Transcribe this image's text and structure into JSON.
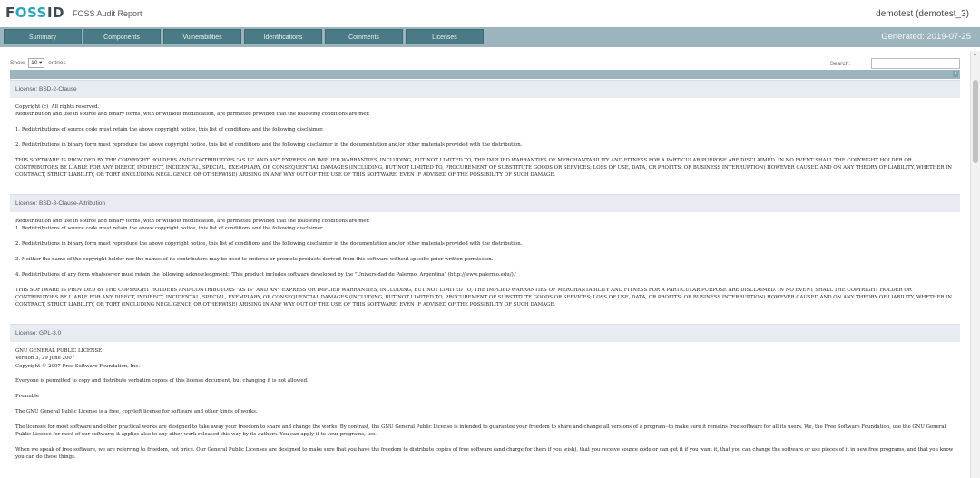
{
  "header": {
    "logo_part1": "F",
    "logo_part2": "OSS",
    "logo_part3": "ID",
    "report_title": "FOSS Audit Report",
    "user": "demotest (demotest_3)"
  },
  "nav": {
    "tabs": [
      "Summary",
      "Components",
      "Vulnerabilities",
      "Identifications",
      "Comments",
      "Licenses"
    ],
    "active": "Licenses",
    "generated": "Generated: 2019-07-25"
  },
  "table_controls": {
    "show_label": "Show",
    "entries_value": "10",
    "entries_label": "entries",
    "search_label": "Search:",
    "search_value": ""
  },
  "licenses": [
    {
      "header": "License: BSD-2-Clause",
      "paragraphs": [
        "Copyright (c)  All rights reserved.\nRedistribution and use in source and binary forms, with or without modification, are permitted provided that the following conditions are met:",
        "1. Redistributions of source code must retain the above copyright notice, this list of conditions and the following disclaimer.",
        "2. Redistributions in binary form must reproduce the above copyright notice, this list of conditions and the following disclaimer in the documentation and/or other materials provided with the distribution.",
        "THIS SOFTWARE IS PROVIDED BY THE COPYRIGHT HOLDERS AND CONTRIBUTORS \"AS IS\" AND ANY EXPRESS OR IMPLIED WARRANTIES, INCLUDING, BUT NOT LIMITED TO, THE IMPLIED WARRANTIES OF MERCHANTABILITY AND FITNESS FOR A PARTICULAR PURPOSE ARE DISCLAIMED. IN NO EVENT SHALL THE COPYRIGHT HOLDER OR CONTRIBUTORS BE LIABLE FOR ANY DIRECT, INDIRECT, INCIDENTAL, SPECIAL, EXEMPLARY, OR CONSEQUENTIAL DAMAGES (INCLUDING, BUT NOT LIMITED TO, PROCUREMENT OF SUBSTITUTE GOODS OR SERVICES; LOSS OF USE, DATA, OR PROFITS; OR BUSINESS INTERRUPTION) HOWEVER CAUSED AND ON ANY THEORY OF LIABILITY, WHETHER IN CONTRACT, STRICT LIABILITY, OR TORT (INCLUDING NEGLIGENCE OR OTHERWISE) ARISING IN ANY WAY OUT OF THE USE OF THIS SOFTWARE, EVEN IF ADVISED OF THE POSSIBILITY OF SUCH DAMAGE."
      ]
    },
    {
      "header": "License: BSD-3-Clause-Attribution",
      "paragraphs": [
        "Redistribution and use in source and binary forms, with or without modification, are permitted provided that the following conditions are met:\n1. Redistributions of source code must retain the above copyright notice, this list of conditions and the following disclaimer.",
        "2. Redistributions in binary form must reproduce the above copyright notice, this list of conditions and the following disclaimer in the documentation and/or other materials provided with the distribution.",
        "3. Neither the name of the copyright holder nor the names of its contributors may be used to endorse or promote products derived from this software without specific prior written permission.",
        "4. Redistributions of any form whatsoever must retain the following acknowledgment: 'This product includes software developed by the \"Universidad de Palermo, Argentina\" (http://www.palermo.edu/).'",
        "THIS SOFTWARE IS PROVIDED BY THE COPYRIGHT HOLDERS AND CONTRIBUTORS \"AS IS\" AND ANY EXPRESS OR IMPLIED WARRANTIES, INCLUDING, BUT NOT LIMITED TO, THE IMPLIED WARRANTIES OF MERCHANTABILITY AND FITNESS FOR A PARTICULAR PURPOSE ARE DISCLAIMED. IN NO EVENT SHALL THE COPYRIGHT HOLDER OR CONTRIBUTORS BE LIABLE FOR ANY DIRECT, INDIRECT, INCIDENTAL, SPECIAL, EXEMPLARY, OR CONSEQUENTIAL DAMAGES (INCLUDING, BUT NOT LIMITED TO, PROCUREMENT OF SUBSTITUTE GOODS OR SERVICES; LOSS OF USE, DATA, OR PROFITS; OR BUSINESS INTERRUPTION) HOWEVER CAUSED AND ON ANY THEORY OF LIABILITY, WHETHER IN CONTRACT, STRICT LIABILITY, OR TORT (INCLUDING NEGLIGENCE OR OTHERWISE) ARISING IN ANY WAY OUT OF THE USE OF THIS SOFTWARE, EVEN IF ADVISED OF THE POSSIBILITY OF SUCH DAMAGE."
      ]
    },
    {
      "header": "License: GPL-3.0",
      "paragraphs": [
        "GNU GENERAL PUBLIC LICENSE\nVersion 3, 29 June 2007\nCopyright © 2007 Free Software Foundation, Inc.",
        "Everyone is permitted to copy and distribute verbatim copies of this license document, but changing it is not allowed.",
        "Preamble",
        "The GNU General Public License is a free, copyleft license for software and other kinds of works.",
        "The licenses for most software and other practical works are designed to take away your freedom to share and change the works. By contrast, the GNU General Public License is intended to guarantee your freedom to share and change all versions of a program--to make sure it remains free software for all its users. We, the Free Software Foundation, use the GNU General Public License for most of our software; it applies also to any other work released this way by its authors. You can apply it to your programs, too.",
        "When we speak of free software, we are referring to freedom, not price. Our General Public Licenses are designed to make sure that you have the freedom to distribute copies of free software (and charge for them if you wish), that you receive source code or can get it if you want it, that you can change the software or use pieces of it in new free programs, and that you know you can do these things."
      ]
    }
  ]
}
